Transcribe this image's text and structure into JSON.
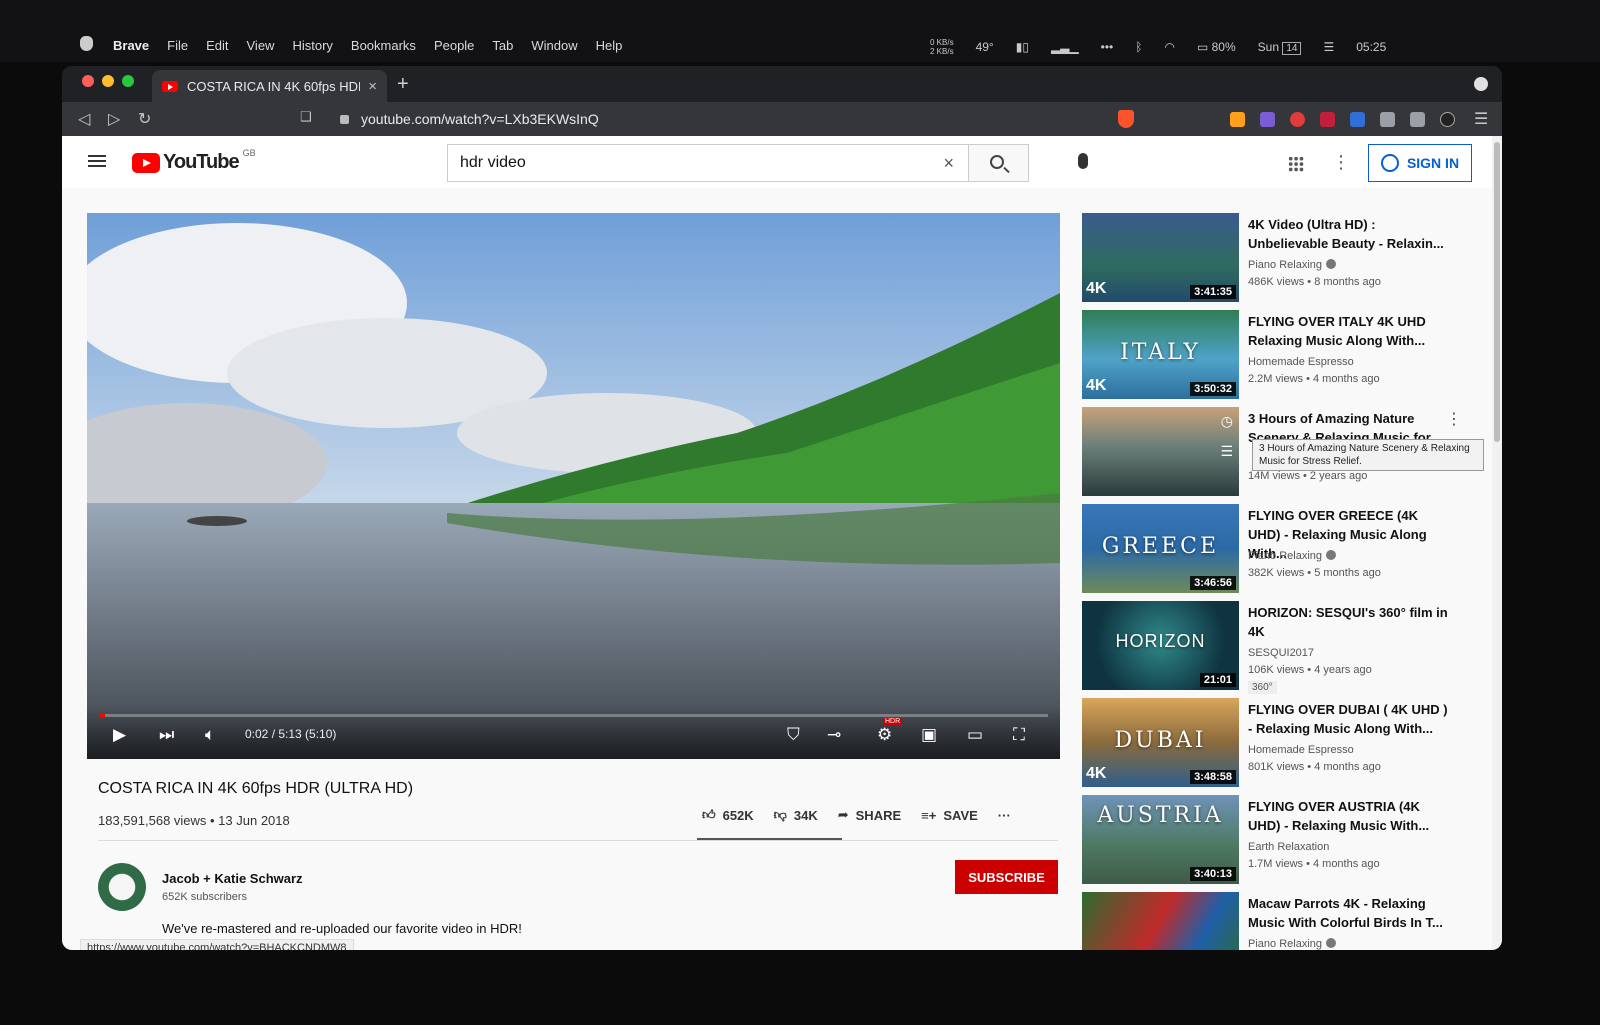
{
  "os_menubar": {
    "app_name": "Brave",
    "menus": [
      "File",
      "Edit",
      "View",
      "History",
      "Bookmarks",
      "People",
      "Tab",
      "Window",
      "Help"
    ],
    "network_up": "0 KB/s",
    "network_down": "2 KB/s",
    "temperature": "49°",
    "battery": "80%",
    "day": "Sun",
    "date": "14",
    "time": "05:25"
  },
  "browser": {
    "tab_title": "COSTA RICA IN 4K 60fps HDR (",
    "tab_close": "×",
    "new_tab": "+",
    "url": "youtube.com/watch?v=LXb3EKWsInQ"
  },
  "masthead": {
    "logo_text": "YouTube",
    "region": "GB",
    "search_value": "hdr video",
    "search_clear": "×",
    "sign_in": "SIGN IN"
  },
  "player": {
    "timecode": "0:02 / 5:13 (5:10)",
    "hdr_badge": "HDR",
    "progress": 0.006
  },
  "video": {
    "title": "COSTA RICA IN 4K 60fps HDR (ULTRA HD)",
    "meta": "183,591,568 views • 13 Jun 2018",
    "likes": "652K",
    "dislikes": "34K",
    "share": "SHARE",
    "save": "SAVE",
    "more": "···",
    "channel": "Jacob + Katie Schwarz",
    "subscribers": "652K subscribers",
    "subscribe": "SUBSCRIBE",
    "description": "We've re-mastered and re-uploaded our favorite video in HDR!"
  },
  "status_url": "https://www.youtube.com/watch?v=BHACKCNDMW8",
  "recommendations": [
    {
      "title": "4K Video (Ultra HD) : Unbelievable Beauty - Relaxin...",
      "channel": "Piano Relaxing",
      "verified": true,
      "views": "486K views • 8 months ago",
      "duration": "3:41:35",
      "overlay": ""
    },
    {
      "title": "FLYING OVER ITALY 4K UHD Relaxing Music Along With...",
      "channel": "Homemade Espresso",
      "verified": false,
      "views": "2.2M views • 4 months ago",
      "duration": "3:50:32",
      "overlay": "ITALY"
    },
    {
      "title": "3 Hours of Amazing Nature Scenery & Relaxing Music for...",
      "channel": "",
      "verified": false,
      "views": "14M views • 2 years ago",
      "duration": "",
      "overlay": ""
    },
    {
      "title": "FLYING OVER GREECE (4K UHD) - Relaxing Music Along With...",
      "channel": "Piano Relaxing",
      "verified": true,
      "views": "382K views • 5 months ago",
      "duration": "3:46:56",
      "overlay": "GREECE"
    },
    {
      "title": "HORIZON: SESQUI's 360° film in 4K",
      "channel": "SESQUI2017",
      "verified": false,
      "views": "106K views • 4 years ago",
      "duration": "21:01",
      "overlay": "HORIZON",
      "badge": "360°"
    },
    {
      "title": "FLYING OVER DUBAI ( 4K UHD ) - Relaxing Music Along With...",
      "channel": "Homemade Espresso",
      "verified": false,
      "views": "801K views • 4 months ago",
      "duration": "3:48:58",
      "overlay": "DUBAI"
    },
    {
      "title": "FLYING OVER AUSTRIA (4K UHD) - Relaxing Music With...",
      "channel": "Earth Relaxation",
      "verified": false,
      "views": "1.7M views • 4 months ago",
      "duration": "3:40:13",
      "overlay": "AUSTRIA"
    },
    {
      "title": "Macaw Parrots 4K - Relaxing Music With Colorful Birds In T...",
      "channel": "Piano Relaxing",
      "verified": true,
      "views": "",
      "duration": "",
      "overlay": ""
    }
  ],
  "tooltip": "3 Hours of Amazing Nature Scenery & Relaxing Music for Stress Relief."
}
